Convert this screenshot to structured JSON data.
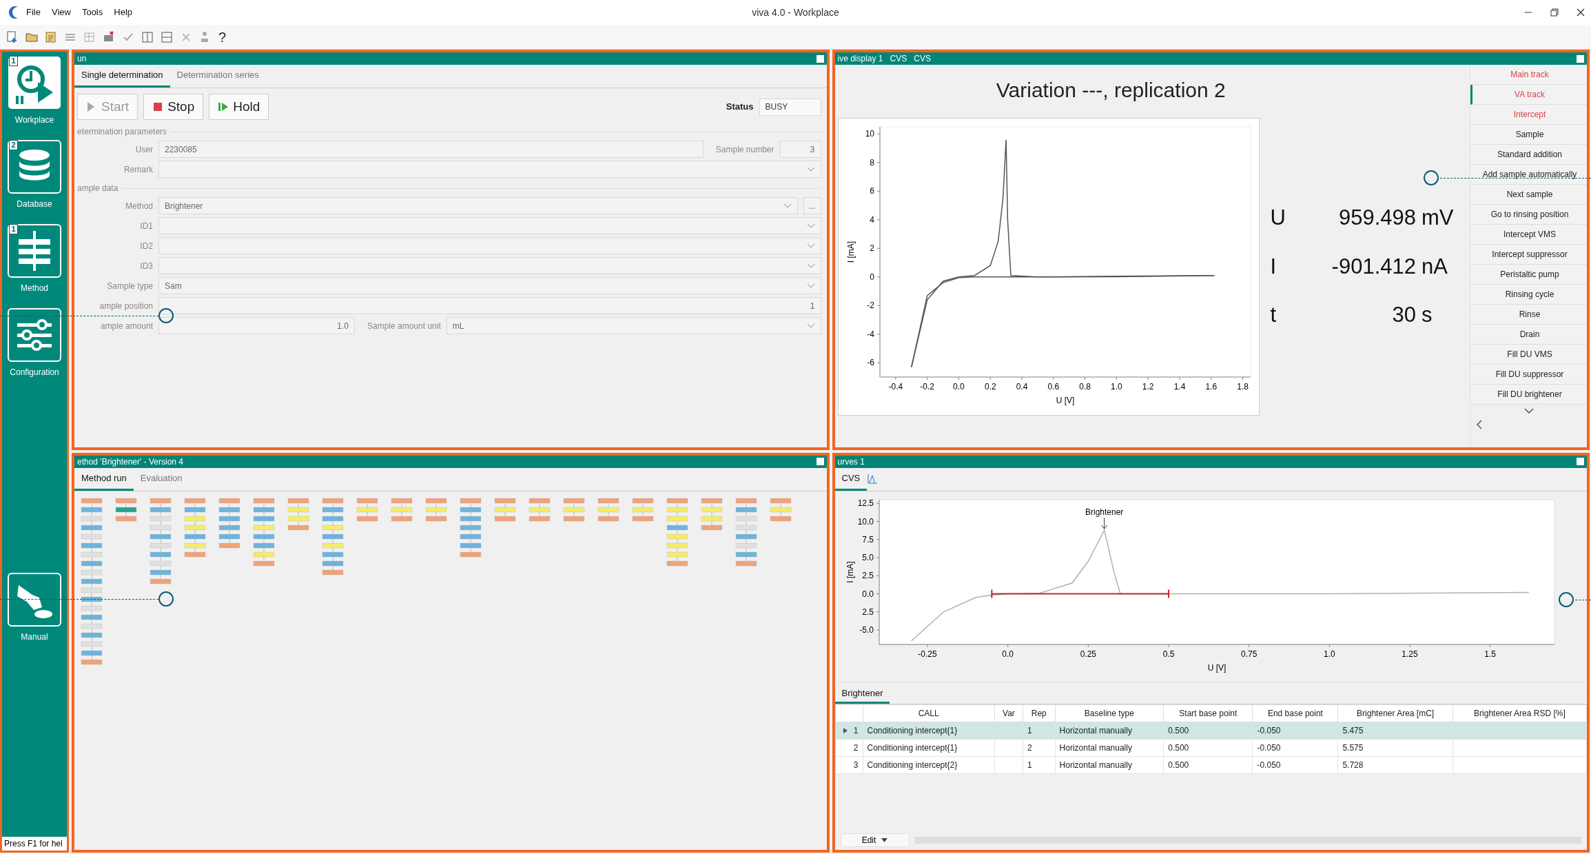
{
  "window": {
    "title": "viva 4.0 - Workplace"
  },
  "menu": [
    "File",
    "View",
    "Tools",
    "Help"
  ],
  "toolbar": {
    "help": "?"
  },
  "sidebar": {
    "items": [
      {
        "label": "Workplace",
        "badge": "1",
        "kind": "workplace",
        "selected": true
      },
      {
        "label": "Database",
        "badge": "2",
        "kind": "database",
        "selected": false
      },
      {
        "label": "Method",
        "badge": "1",
        "kind": "method",
        "selected": false
      },
      {
        "label": "Configuration",
        "kind": "configuration",
        "selected": false
      },
      {
        "label": "Manual",
        "kind": "manual",
        "selected": false
      }
    ],
    "status": "Press F1 for hel"
  },
  "run_panel": {
    "title": "un",
    "tabs": [
      {
        "label": "Single determination",
        "selected": true
      },
      {
        "label": "Determination series",
        "selected": false
      }
    ],
    "buttons": [
      {
        "label": "Start",
        "kind": "start",
        "disabled": true
      },
      {
        "label": "Stop",
        "kind": "stop",
        "disabled": false
      },
      {
        "label": "Hold",
        "kind": "hold",
        "disabled": false
      }
    ],
    "status_label": "Status",
    "status_value": "BUSY",
    "sections": [
      {
        "title": "etermination parameters",
        "rows": [
          [
            {
              "label": "User",
              "value": "2230085",
              "kind": "text"
            },
            {
              "label": "Sample number",
              "value": "3",
              "kind": "number"
            }
          ],
          [
            {
              "label": "Remark",
              "kind": "dropdown"
            }
          ]
        ]
      },
      {
        "title": "ample data",
        "rows": [
          [
            {
              "label": "Method",
              "value": "Brightener",
              "kind": "dropdown",
              "more": "..."
            }
          ],
          [
            {
              "label": "ID1",
              "kind": "dropdown"
            }
          ],
          [
            {
              "label": "ID2",
              "kind": "dropdown"
            }
          ],
          [
            {
              "label": "ID3",
              "kind": "dropdown"
            }
          ],
          [
            {
              "label": "Sample type",
              "value": "Sam",
              "kind": "dropdown"
            }
          ],
          [
            {
              "label": "ample position",
              "value": "1",
              "kind": "number"
            }
          ],
          [
            {
              "label": "ample amount",
              "value": "1.0",
              "kind": "number"
            },
            {
              "label": "Sample amount unit",
              "value": "mL",
              "kind": "dropdown"
            }
          ]
        ]
      }
    ]
  },
  "live_panel": {
    "title_parts": [
      "ive display 1",
      "CVS",
      "CVS"
    ],
    "heading": "Variation ---, replication 2",
    "chart_data": {
      "type": "line",
      "xlabel": "U [V]",
      "ylabel": "I [mA]",
      "x": [
        -0.3,
        -0.2,
        -0.1,
        0,
        0.1,
        0.2,
        0.25,
        0.28,
        0.3,
        0.31,
        0.33,
        0.5,
        1.0,
        1.62
      ],
      "series": [
        {
          "color": "#555555",
          "values": [
            -6.3,
            -1.6,
            -0.3,
            0,
            0.1,
            0.8,
            2.5,
            5.5,
            9.6,
            4,
            0.1,
            0,
            0.05,
            0.1
          ]
        },
        {
          "color": "#555555",
          "values": [
            -6.3,
            -1.3,
            -0.4,
            -0.05,
            0,
            0,
            0,
            0,
            0,
            0,
            0,
            0,
            0.02,
            0.1
          ]
        }
      ],
      "xlim": [
        -0.5,
        1.85
      ],
      "ylim": [
        -7,
        10.5
      ],
      "xticks": [
        -0.4,
        -0.2,
        {
          "value": 0,
          "label": "0.0"
        },
        0.2,
        0.4,
        0.6,
        0.8,
        {
          "value": 1,
          "label": "1.0"
        },
        1.2,
        1.4,
        1.6,
        1.8
      ],
      "yticks": [
        10,
        8,
        6,
        4,
        2,
        0,
        -2,
        -4,
        -6
      ]
    },
    "readouts": [
      {
        "symbol": "U",
        "value": "959.498",
        "unit": "mV"
      },
      {
        "symbol": "I",
        "value": "-901.412",
        "unit": "nA"
      },
      {
        "symbol": "t",
        "value": "30",
        "unit": "s"
      }
    ],
    "actions": [
      {
        "label": "Main track",
        "kind": "track",
        "selected": false
      },
      {
        "label": "VA track",
        "kind": "track",
        "selected": true
      },
      {
        "label": "Intercept",
        "kind": "track",
        "selected": false
      },
      {
        "label": "Sample",
        "kind": "action",
        "selected": false
      },
      {
        "label": "Standard addition",
        "kind": "action",
        "selected": false
      },
      {
        "label": "Add sample automatically",
        "kind": "action",
        "selected": false
      },
      {
        "label": "Next sample",
        "kind": "action",
        "selected": false
      },
      {
        "label": "Go to rinsing position",
        "kind": "action",
        "selected": false
      },
      {
        "label": "Intercept VMS",
        "kind": "action",
        "selected": false
      },
      {
        "label": "Intercept suppressor",
        "kind": "action",
        "selected": false
      },
      {
        "label": "Peristaltic pump",
        "kind": "action",
        "selected": false
      },
      {
        "label": "Rinsing cycle",
        "kind": "action",
        "selected": false
      },
      {
        "label": "Rinse",
        "kind": "action",
        "selected": false
      },
      {
        "label": "Drain",
        "kind": "action",
        "selected": false
      },
      {
        "label": "Fill DU VMS",
        "kind": "action",
        "selected": false
      },
      {
        "label": "Fill DU suppressor",
        "kind": "action",
        "selected": false
      },
      {
        "label": "Fill DU brightener",
        "kind": "action",
        "selected": false
      }
    ]
  },
  "method_panel": {
    "title": "ethod 'Brightener' - Version 4",
    "tabs": [
      {
        "label": "Method run",
        "selected": true
      },
      {
        "label": "Evaluation",
        "selected": false
      }
    ]
  },
  "curves_panel": {
    "title": "urves 1",
    "tabs": [
      {
        "label": "CVS",
        "selected": true
      }
    ],
    "chart_data": {
      "type": "line",
      "xlabel": "U [V]",
      "ylabel": "I [mA]",
      "x": [
        -0.3,
        -0.2,
        -0.1,
        -0.05,
        0,
        0.1,
        0.2,
        0.25,
        0.3,
        0.33,
        0.35,
        0.5,
        1.0,
        1.62
      ],
      "series": [
        {
          "color": "#b0b0b0",
          "values": [
            -6.5,
            -2.5,
            -0.5,
            -0.2,
            0,
            0.1,
            1.5,
            4.5,
            8.8,
            3,
            0,
            0,
            0,
            0.2
          ]
        },
        {
          "color": "#c0282d",
          "values": [
            null,
            null,
            null,
            0,
            0,
            0,
            0,
            0,
            0,
            0,
            0,
            0,
            null,
            null
          ]
        }
      ],
      "xlim": [
        -0.4,
        1.7
      ],
      "ylim": [
        -7,
        13
      ],
      "xticks": [
        -0.25,
        {
          "value": 0,
          "label": "0.0"
        },
        0.25,
        0.5,
        0.75,
        {
          "value": 1,
          "label": "1.0"
        },
        1.25,
        1.5
      ],
      "yticks": [
        12.5,
        {
          "value": 10,
          "label": "10.0"
        },
        7.5,
        {
          "value": 5,
          "label": "5.0"
        },
        2.5,
        {
          "value": 0,
          "label": "0.0"
        },
        {
          "value": -2.5,
          "label": "2.5"
        },
        {
          "value": -5,
          "label": "-5.0"
        }
      ],
      "annotations": [
        {
          "text": "Brightener",
          "x": 0.3,
          "y": 8.8
        }
      ]
    },
    "table_tabs": [
      {
        "label": "Brightener",
        "selected": true
      }
    ],
    "table": {
      "columns": [
        "CALL",
        "Var",
        "Rep",
        "Baseline type",
        "Start base point",
        "End base point",
        "Brightener Area [mC]",
        "Brightener Area RSD [%]"
      ],
      "rows": [
        {
          "n": "1",
          "call": "Conditioning intercept{1}",
          "rep": "1",
          "baseline": "Horizontal manually",
          "start": "0.500",
          "end": "-0.050",
          "area": "5.475",
          "selected": true
        },
        {
          "n": "2",
          "call": "Conditioning intercept{1}",
          "rep": "2",
          "baseline": "Horizontal manually",
          "start": "0.500",
          "end": "-0.050",
          "area": "5.575",
          "selected": false
        },
        {
          "n": "3",
          "call": "Conditioning intercept{2}",
          "rep": "1",
          "baseline": "Horizontal manually",
          "start": "0.500",
          "end": "-0.050",
          "area": "5.728",
          "selected": false
        }
      ]
    },
    "edit_button": "Edit"
  }
}
